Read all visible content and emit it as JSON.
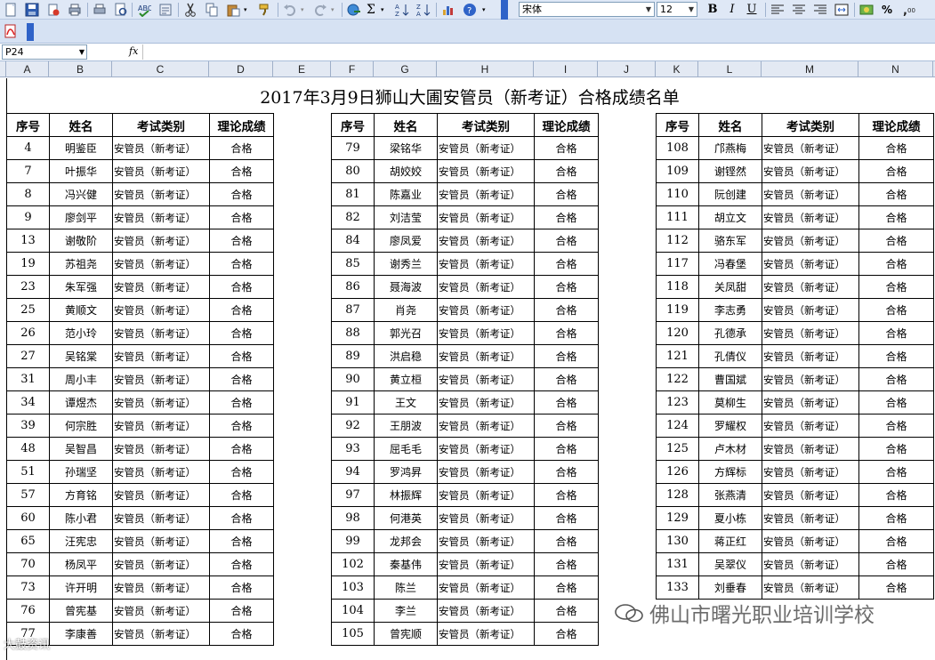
{
  "toolbar": {
    "font_name": "宋体",
    "font_size": "12",
    "bold_label": "B",
    "italic_label": "I",
    "underline_label": "U",
    "percent_label": "%",
    "sum_label": "Σ"
  },
  "formula_bar": {
    "name_box": "P24",
    "fx_label": "fx"
  },
  "columns": [
    "A",
    "B",
    "C",
    "D",
    "E",
    "F",
    "G",
    "H",
    "I",
    "J",
    "K",
    "L",
    "M",
    "N"
  ],
  "sheet": {
    "title": "2017年3月9日狮山大圃安管员（新考证）合格成绩名单",
    "headers": [
      "序号",
      "姓名",
      "考试类别",
      "理论成绩"
    ],
    "block1": [
      [
        "4",
        "明鉴臣",
        "安管员（新考证）",
        "合格"
      ],
      [
        "7",
        "叶振华",
        "安管员（新考证）",
        "合格"
      ],
      [
        "8",
        "冯兴健",
        "安管员（新考证）",
        "合格"
      ],
      [
        "9",
        "廖剑平",
        "安管员（新考证）",
        "合格"
      ],
      [
        "13",
        "谢敬阶",
        "安管员（新考证）",
        "合格"
      ],
      [
        "19",
        "苏祖尧",
        "安管员（新考证）",
        "合格"
      ],
      [
        "23",
        "朱军强",
        "安管员（新考证）",
        "合格"
      ],
      [
        "25",
        "黄顺文",
        "安管员（新考证）",
        "合格"
      ],
      [
        "26",
        "范小玲",
        "安管员（新考证）",
        "合格"
      ],
      [
        "27",
        "吴铭棠",
        "安管员（新考证）",
        "合格"
      ],
      [
        "31",
        "周小丰",
        "安管员（新考证）",
        "合格"
      ],
      [
        "34",
        "谭煜杰",
        "安管员（新考证）",
        "合格"
      ],
      [
        "39",
        "何宗胜",
        "安管员（新考证）",
        "合格"
      ],
      [
        "48",
        "吴智昌",
        "安管员（新考证）",
        "合格"
      ],
      [
        "51",
        "孙瑞坚",
        "安管员（新考证）",
        "合格"
      ],
      [
        "57",
        "方育铭",
        "安管员（新考证）",
        "合格"
      ],
      [
        "60",
        "陈小君",
        "安管员（新考证）",
        "合格"
      ],
      [
        "65",
        "汪宪忠",
        "安管员（新考证）",
        "合格"
      ],
      [
        "70",
        "杨凤平",
        "安管员（新考证）",
        "合格"
      ],
      [
        "73",
        "许开明",
        "安管员（新考证）",
        "合格"
      ],
      [
        "76",
        "曾宪基",
        "安管员（新考证）",
        "合格"
      ],
      [
        "77",
        "李康善",
        "安管员（新考证）",
        "合格"
      ]
    ],
    "block2": [
      [
        "79",
        "梁铭华",
        "安管员（新考证）",
        "合格"
      ],
      [
        "80",
        "胡姣姣",
        "安管员（新考证）",
        "合格"
      ],
      [
        "81",
        "陈嘉业",
        "安管员（新考证）",
        "合格"
      ],
      [
        "82",
        "刘洁莹",
        "安管员（新考证）",
        "合格"
      ],
      [
        "84",
        "廖凤爱",
        "安管员（新考证）",
        "合格"
      ],
      [
        "85",
        "谢秀兰",
        "安管员（新考证）",
        "合格"
      ],
      [
        "86",
        "聂海波",
        "安管员（新考证）",
        "合格"
      ],
      [
        "87",
        "肖尧",
        "安管员（新考证）",
        "合格"
      ],
      [
        "88",
        "郭光召",
        "安管员（新考证）",
        "合格"
      ],
      [
        "89",
        "洪启稳",
        "安管员（新考证）",
        "合格"
      ],
      [
        "90",
        "黄立桓",
        "安管员（新考证）",
        "合格"
      ],
      [
        "91",
        "王文",
        "安管员（新考证）",
        "合格"
      ],
      [
        "92",
        "王朋波",
        "安管员（新考证）",
        "合格"
      ],
      [
        "93",
        "屈毛毛",
        "安管员（新考证）",
        "合格"
      ],
      [
        "94",
        "罗鸿昇",
        "安管员（新考证）",
        "合格"
      ],
      [
        "97",
        "林振辉",
        "安管员（新考证）",
        "合格"
      ],
      [
        "98",
        "何港英",
        "安管员（新考证）",
        "合格"
      ],
      [
        "99",
        "龙邦会",
        "安管员（新考证）",
        "合格"
      ],
      [
        "102",
        "秦基伟",
        "安管员（新考证）",
        "合格"
      ],
      [
        "103",
        "陈兰",
        "安管员（新考证）",
        "合格"
      ],
      [
        "104",
        "李兰",
        "安管员（新考证）",
        "合格"
      ],
      [
        "105",
        "曾宪顺",
        "安管员（新考证）",
        "合格"
      ]
    ],
    "block3": [
      [
        "108",
        "邝燕梅",
        "安管员（新考证）",
        "合格"
      ],
      [
        "109",
        "谢铿然",
        "安管员（新考证）",
        "合格"
      ],
      [
        "110",
        "阮创建",
        "安管员（新考证）",
        "合格"
      ],
      [
        "111",
        "胡立文",
        "安管员（新考证）",
        "合格"
      ],
      [
        "112",
        "骆东军",
        "安管员（新考证）",
        "合格"
      ],
      [
        "117",
        "冯春堡",
        "安管员（新考证）",
        "合格"
      ],
      [
        "118",
        "关凤甜",
        "安管员（新考证）",
        "合格"
      ],
      [
        "119",
        "李志勇",
        "安管员（新考证）",
        "合格"
      ],
      [
        "120",
        "孔德承",
        "安管员（新考证）",
        "合格"
      ],
      [
        "121",
        "孔倩仪",
        "安管员（新考证）",
        "合格"
      ],
      [
        "122",
        "曹国斌",
        "安管员（新考证）",
        "合格"
      ],
      [
        "123",
        "莫柳生",
        "安管员（新考证）",
        "合格"
      ],
      [
        "124",
        "罗耀权",
        "安管员（新考证）",
        "合格"
      ],
      [
        "125",
        "卢木材",
        "安管员（新考证）",
        "合格"
      ],
      [
        "126",
        "方辉标",
        "安管员（新考证）",
        "合格"
      ],
      [
        "128",
        "张燕清",
        "安管员（新考证）",
        "合格"
      ],
      [
        "129",
        "夏小栋",
        "安管员（新考证）",
        "合格"
      ],
      [
        "130",
        "蒋正红",
        "安管员（新考证）",
        "合格"
      ],
      [
        "131",
        "吴翠仪",
        "安管员（新考证）",
        "合格"
      ],
      [
        "133",
        "刘垂春",
        "安管员（新考证）",
        "合格"
      ]
    ]
  },
  "watermark": {
    "school": "佛山市曙光职业培训学校",
    "corner": "大鼓资讯"
  }
}
